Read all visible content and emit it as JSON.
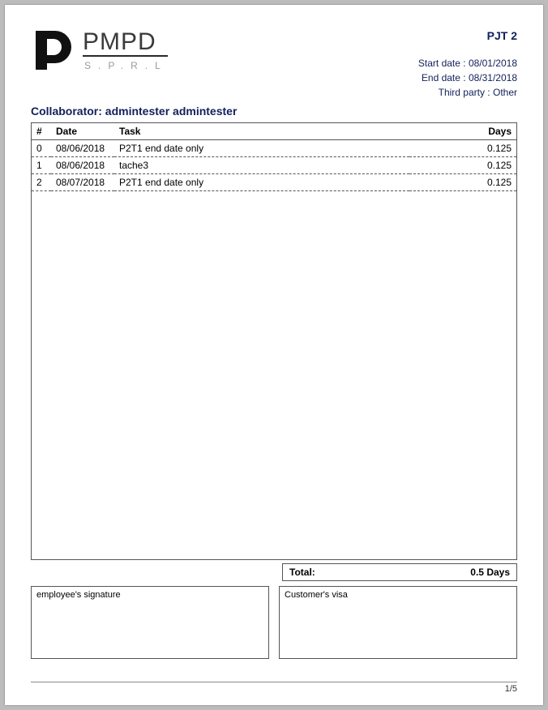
{
  "logo": {
    "main": "PMPD",
    "sub": "S.P.R.L"
  },
  "meta": {
    "project_title": "PJT 2",
    "start_label": "Start date : ",
    "start_value": "08/01/2018",
    "end_label": "End date : ",
    "end_value": "08/31/2018",
    "third_label": "Third party : ",
    "third_value": "Other"
  },
  "collaborator": {
    "label": "Collaborator: ",
    "name": "admintester admintester"
  },
  "columns": {
    "idx": "#",
    "date": "Date",
    "task": "Task",
    "days": "Days"
  },
  "rows": [
    {
      "idx": "0",
      "date": "08/06/2018",
      "task": "P2T1 end date only",
      "days": "0.125"
    },
    {
      "idx": "1",
      "date": "08/06/2018",
      "task": "tache3",
      "days": "0.125"
    },
    {
      "idx": "2",
      "date": "08/07/2018",
      "task": "P2T1 end date only",
      "days": "0.125"
    }
  ],
  "totals": {
    "label": "Total:",
    "value": "0.5 Days"
  },
  "signatures": {
    "employee": "employee's signature",
    "customer": "Customer's visa"
  },
  "pager": "1/5"
}
